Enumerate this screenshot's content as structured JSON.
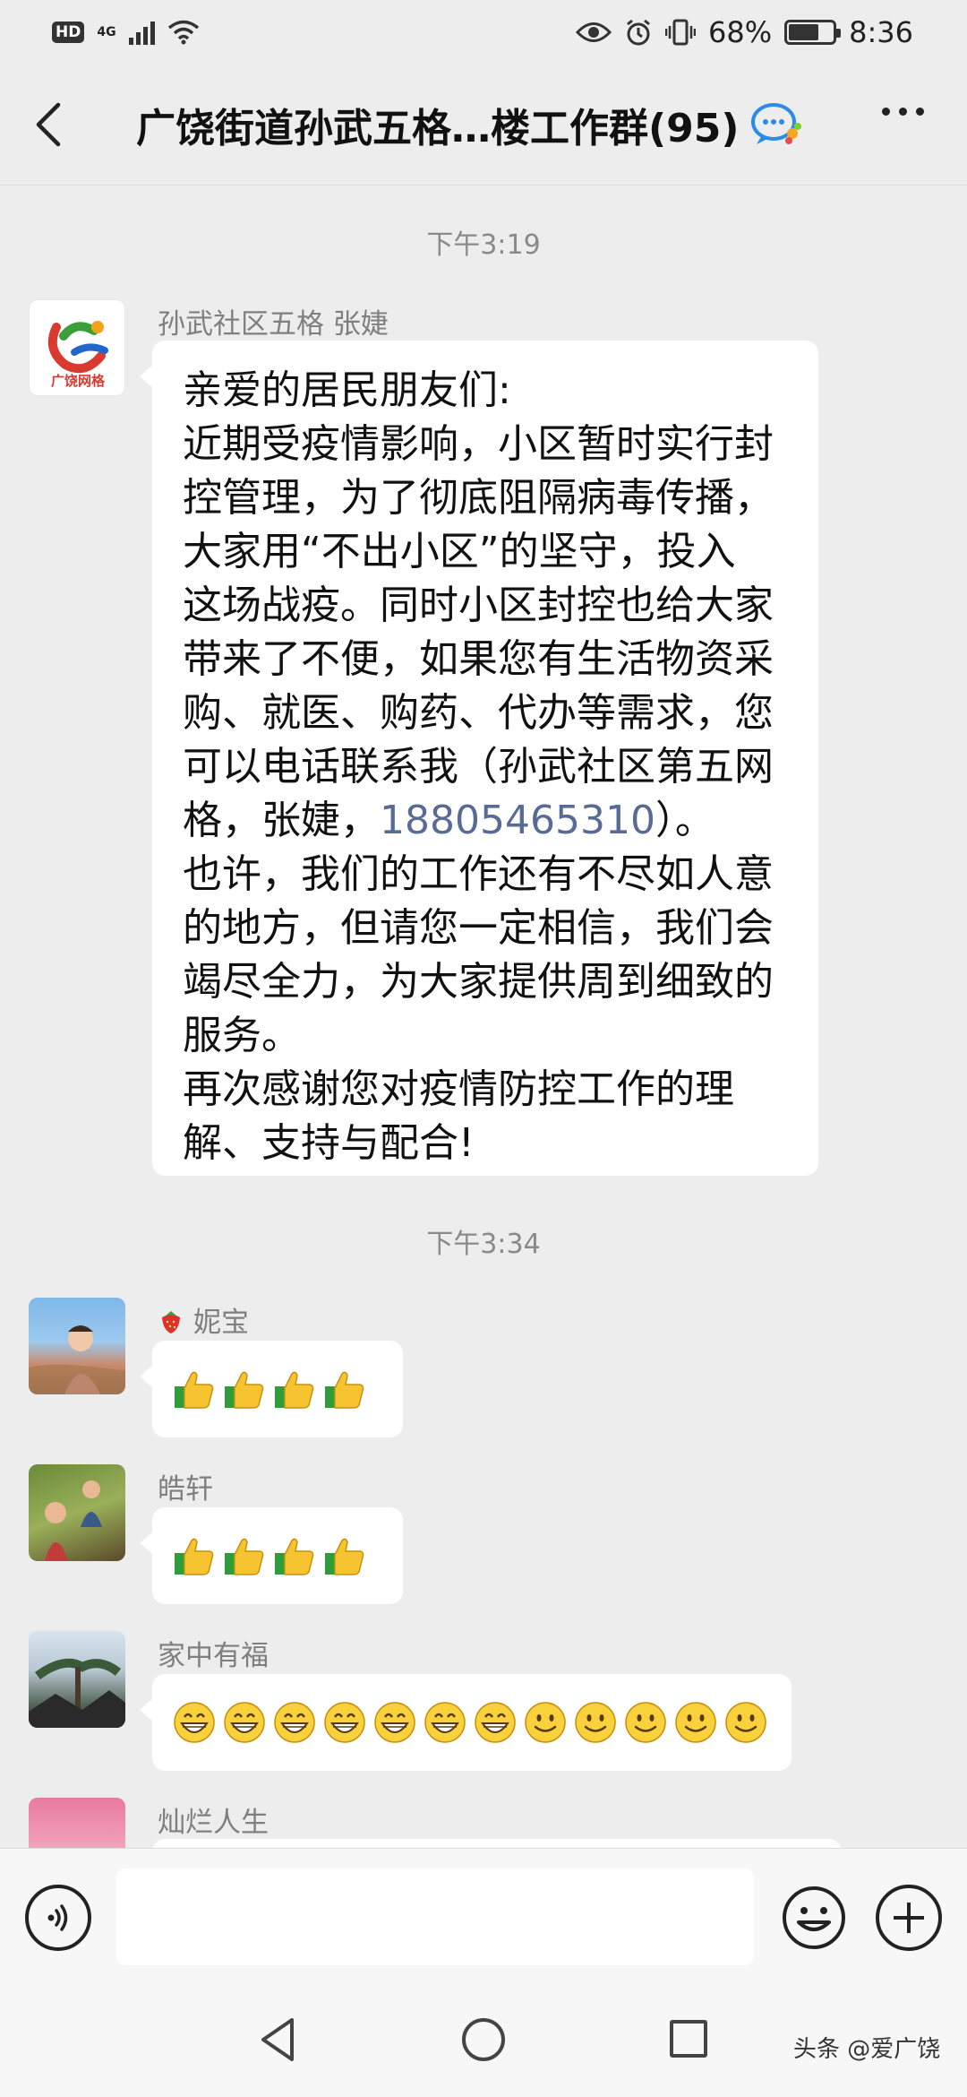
{
  "status_bar": {
    "hd": "HD",
    "network": "4G",
    "battery_percent": "68%",
    "time": "8:36",
    "battery_level": 0.68
  },
  "header": {
    "title": "广饶街道孙武五格…楼工作群(95)"
  },
  "timestamps": [
    "下午3:19",
    "下午3:34"
  ],
  "messages": [
    {
      "sender": "孙武社区五格 张婕",
      "avatar_text": "广饶网格",
      "lines": [
        "亲爱的居民朋友们:",
        "近期受疫情影响，小区暂时实行封",
        "控管理，为了彻底阻隔病毒传播，",
        "大家用“不出小区”的坚守，投入",
        "这场战疫。同时小区封控也给大家",
        "带来了不便，如果您有生活物资采",
        "购、就医、购药、代办等需求，您",
        "可以电话联系我（孙武社区第五网"
      ],
      "line_phone_prefix": "格，张婕，",
      "phone": "18805465310",
      "line_phone_suffix": "）。",
      "lines_after": [
        "也许，我们的工作还有不尽如人意",
        "的地方，但请您一定相信，我们会",
        "竭尽全力，为大家提供周到细致的",
        "服务。",
        "再次感谢您对疫情防控工作的理",
        "解、支持与配合!"
      ]
    },
    {
      "sender": "妮宝",
      "sender_icon": "strawberry-icon",
      "emojis": [
        "thumbs-up-icon",
        "thumbs-up-icon",
        "thumbs-up-icon",
        "thumbs-up-icon"
      ]
    },
    {
      "sender": "皓轩",
      "emojis": [
        "thumbs-up-icon",
        "thumbs-up-icon",
        "thumbs-up-icon",
        "thumbs-up-icon"
      ]
    },
    {
      "sender": "家中有福",
      "emojis": [
        "grin-icon",
        "grin-icon",
        "grin-icon",
        "grin-icon",
        "grin-icon",
        "grin-icon",
        "grin-icon",
        "smile-icon",
        "smile-icon",
        "smile-icon",
        "smile-icon",
        "smile-icon"
      ]
    },
    {
      "sender": "灿烂人生"
    }
  ],
  "watermark": "头条 @爱广饶",
  "colors": {
    "background": "#ededed",
    "bubble": "#ffffff",
    "link": "#576b95"
  }
}
